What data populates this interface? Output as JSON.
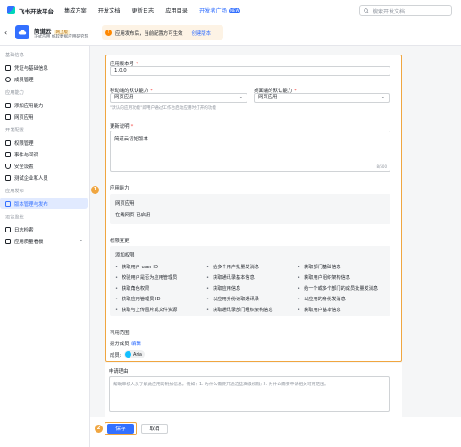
{
  "topbar": {
    "logo": "飞书开放平台",
    "nav": [
      "集成方案",
      "开发文档",
      "更新日志",
      "应用目录",
      "开发者广场"
    ],
    "new_badge": "NEW",
    "search_placeholder": "搜索开发文档"
  },
  "app": {
    "name": "简道云",
    "tag": "网上版",
    "subtitle": "正式应用 帆软数据应用研究院",
    "notice": "应用发布后，当前配置方可生效",
    "notice_link": "创建版本"
  },
  "sidebar": {
    "groups": [
      {
        "title": "基础信息",
        "items": [
          "凭证与基础信息",
          "成员管理"
        ]
      },
      {
        "title": "应用能力",
        "items": [
          "添加应用能力",
          "网页应用"
        ]
      },
      {
        "title": "开发配置",
        "items": [
          "权限管理",
          "事件与回调",
          "安全设置",
          "测试企业和人员"
        ]
      },
      {
        "title": "应用发布",
        "items": [
          "版本管理与发布"
        ]
      },
      {
        "title": "运营监控",
        "items": [
          "日志检索",
          "应用质量看板"
        ]
      }
    ]
  },
  "form": {
    "version_label": "应用版本号",
    "version_value": "1.0.0",
    "mobile_default_label": "移动端的默认能力",
    "mobile_default_value": "网页应用",
    "mobile_hint": "\"默认的应用功能\"即用户通过工作台启动应用时打开的功能",
    "desktop_default_label": "桌面端的默认能力",
    "desktop_default_value": "网页应用",
    "update_label": "更新说明",
    "update_value": "简道云初始版本",
    "update_counter": "8/500",
    "capability_label": "应用能力",
    "capability_title": "网页应用",
    "capability_desc": "在线网页 已启用",
    "permission_label": "权限变更",
    "permission_sub": "添加权限",
    "permissions": [
      [
        "获取用户 user ID",
        "给多个用户批量发消息",
        "获取部门基础信息"
      ],
      [
        "校验用户是否为应用管理员",
        "获取通讯录基本信息",
        "获取用户组织架构信息"
      ],
      [
        "获取角色权限",
        "获取应用信息",
        "给一个或多个部门的成员批量发消息"
      ],
      [
        "获取应用管理员 ID",
        "以应用身份读取通讯录",
        "以应用的身份发消息"
      ],
      [
        "获取与上传图片或文件资源",
        "获取通讯录部门组织架构信息",
        "获取用户基本信息"
      ]
    ],
    "scope_label": "可用范围",
    "scope_sub": "拨分成员",
    "scope_edit": "编辑",
    "member_label": "成员:",
    "member_name": "Aria"
  },
  "reason": {
    "label": "申请理由",
    "placeholder": "帮助审核人员了解此应用的附加信息。例如：1. 为什么需要开通这些高级权限; 2. 为什么需要申请相关可用范围。"
  },
  "footer": {
    "save": "保存",
    "cancel": "取消"
  },
  "steps": [
    "1",
    "2"
  ]
}
